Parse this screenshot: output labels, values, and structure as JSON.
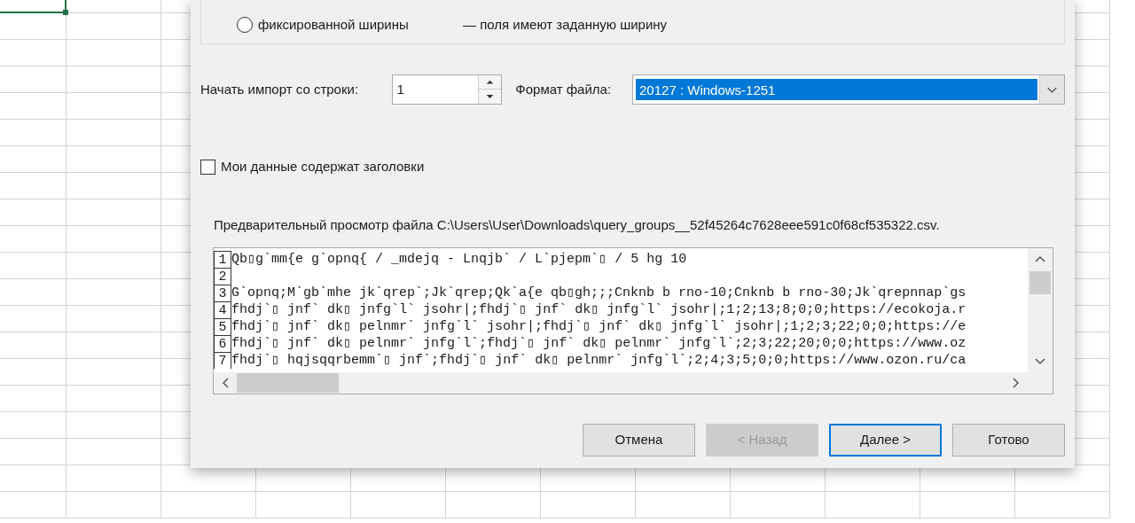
{
  "options_group": {
    "radios": [
      {
        "label": "фиксированной ширины",
        "description": "— поля имеют заданную ширину",
        "selected": false
      }
    ]
  },
  "start_row": {
    "label": "Начать импорт со строки:",
    "value": "1"
  },
  "file_format": {
    "label": "Формат файла:",
    "value": "20127 : Windows-1251"
  },
  "headers_checkbox": {
    "label": "Мои данные содержат заголовки",
    "checked": false
  },
  "preview": {
    "title": "Предварительный просмотр файла C:\\Users\\User\\Downloads\\query_groups__52f45264c7628eee591c0f68cf535322.csv.",
    "lines": [
      {
        "number": "1",
        "text": "Qb▯g`mm{e g`opnq{ / _mdejq - Lnqjb` / L`pjepm`▯ / 5 hg 10"
      },
      {
        "number": "2"
      },
      {
        "number": "3",
        "text": "G`opnq;M`gb`mhe jk`qrep`;Jk`qrep;Qk`a{e qb▯gh;;;Cnknb b rno-10;Cnknb b rno-30;Jk`qrepnnap`gs"
      },
      {
        "number": "4",
        "text": "fhdj`▯ jnf` dk▯ jnfg`l` jsohr|;fhdj`▯ jnf` dk▯ jnfg`l` jsohr|;1;2;13;8;0;0;https://ecokoja.r"
      },
      {
        "number": "5",
        "text": "fhdj`▯ jnf` dk▯ pelnmr` jnfg`l` jsohr|;fhdj`▯ jnf` dk▯ jnfg`l` jsohr|;1;2;3;22;0;0;https://e"
      },
      {
        "number": "6",
        "text": "fhdj`▯ jnf` dk▯ pelnmr` jnfg`l`;fhdj`▯ jnf` dk▯ pelnmr` jnfg`l`;2;3;22;20;0;0;https://www.oz"
      },
      {
        "number": "7",
        "text": "fhdj`▯ hqjsqqrbemm`▯ jnf`;fhdj`▯ jnf` dk▯ pelnmr` jnfg`l`;2;4;3;5;0;0;https://www.ozon.ru/ca"
      }
    ]
  },
  "buttons": [
    {
      "label": "Отмена",
      "disabled": false,
      "default": false
    },
    {
      "label": "< Назад",
      "disabled": true,
      "default": false
    },
    {
      "label": "Далее >",
      "disabled": false,
      "default": true
    },
    {
      "label": "Готово",
      "disabled": false,
      "default": false
    }
  ]
}
